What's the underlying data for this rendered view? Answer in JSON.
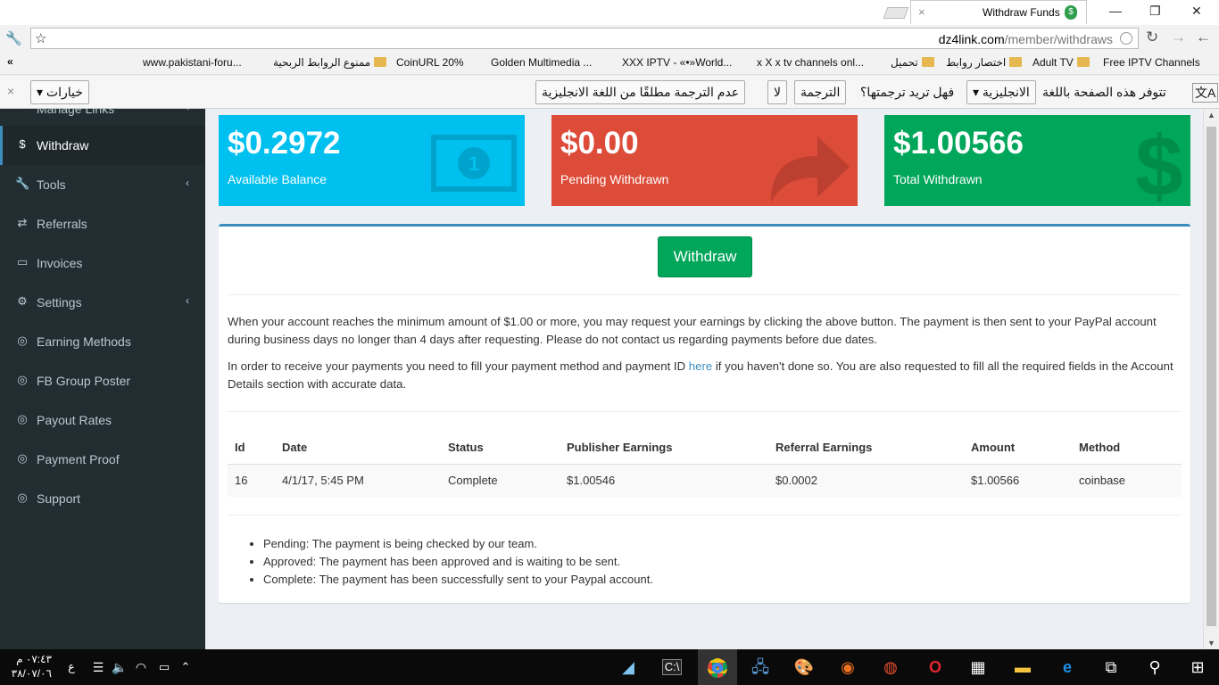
{
  "browser": {
    "tab_title": "Withdraw Funds",
    "tab_close": "×",
    "url_host": "dz4link.com",
    "url_path": "/member/withdraws",
    "bookmarks_more": "«",
    "bookmarks": [
      "www.pakistani-foru...",
      "ممنوع الروابط الربحية",
      "CoinURL 20%",
      "Golden Multimedia ...",
      "XXX IPTV - «•»World...",
      "x X x tv channels onl...",
      "تحميل",
      "اختصار روابط",
      "Adult TV",
      "Free IPTV Channels"
    ]
  },
  "translate_bar": {
    "prompt": "تتوفر هذه الصفحة باللغة",
    "language": "الانجليزية",
    "question": "فهل تريد ترجمتها؟",
    "translate_button": "الترجمة",
    "no_button": "لا",
    "never_button": "عدم الترجمة مطلقًا من اللغة الانجليزية",
    "options_button": "خيارات",
    "close": "×"
  },
  "sidebar": {
    "partial_item": "Manage Links",
    "items": [
      {
        "label": "Withdraw",
        "icon": "dollar-icon",
        "glyph": "$"
      },
      {
        "label": "Tools",
        "icon": "wrench-icon",
        "glyph": "🔧"
      },
      {
        "label": "Referrals",
        "icon": "exchange-icon",
        "glyph": "⇄"
      },
      {
        "label": "Invoices",
        "icon": "credit-card-icon",
        "glyph": "▭"
      },
      {
        "label": "Settings",
        "icon": "cogs-icon",
        "glyph": "⚙"
      },
      {
        "label": "Earning Methods",
        "icon": "lifebuoy-icon",
        "glyph": "◎"
      },
      {
        "label": "FB Group Poster",
        "icon": "lifebuoy-icon",
        "glyph": "◎"
      },
      {
        "label": "Payout Rates",
        "icon": "lifebuoy-icon",
        "glyph": "◎"
      },
      {
        "label": "Payment Proof",
        "icon": "lifebuoy-icon",
        "glyph": "◎"
      },
      {
        "label": "Support",
        "icon": "lifebuoy-icon",
        "glyph": "◎"
      }
    ],
    "chevron": "‹"
  },
  "stats": [
    {
      "amount": "$0.2972",
      "caption": "Available Balance",
      "color": "#00c0ef",
      "icon": "money-bill-icon"
    },
    {
      "amount": "$0.00",
      "caption": "Pending Withdrawn",
      "color": "#dd4b39",
      "icon": "share-arrow-icon"
    },
    {
      "amount": "$1.00566",
      "caption": "Total Withdrawn",
      "color": "#00a65a",
      "icon": "dollar-sign-icon"
    }
  ],
  "withdraw": {
    "button_label": "Withdraw",
    "paragraph1": "When your account reaches the minimum amount of $1.00 or more, you may request your earnings by clicking the above button. The payment is then sent to your PayPal account during business days no longer than 4 days after requesting. Please do not contact us regarding payments before due dates.",
    "paragraph2_before": "In order to receive your payments you need to fill your payment method and payment ID ",
    "paragraph2_link": "here",
    "paragraph2_after": " if you haven't done so. You are also requested to fill all the required fields in the Account Details section with accurate data."
  },
  "table": {
    "headers": [
      "Id",
      "Date",
      "Status",
      "Publisher Earnings",
      "Referral Earnings",
      "Amount",
      "Method"
    ],
    "rows": [
      [
        "16",
        "4/1/17, 5:45 PM",
        "Complete",
        "$1.00546",
        "$0.0002",
        "$1.00566",
        "coinbase"
      ]
    ]
  },
  "legend": [
    "Pending: The payment is being checked by our team.",
    "Approved: The payment has been approved and is waiting to be sent.",
    "Complete: The payment has been successfully sent to your Paypal account."
  ],
  "taskbar": {
    "time": "٠٧:٤٣ م",
    "date": "٣٨/٠٧/٠٦",
    "lang": "ع"
  }
}
